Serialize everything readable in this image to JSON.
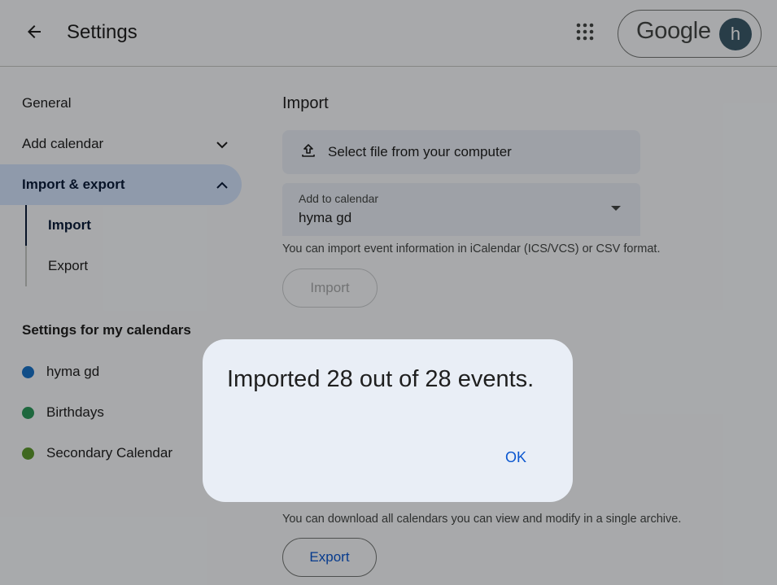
{
  "header": {
    "title": "Settings",
    "logo_text": "Google",
    "avatar_letter": "h"
  },
  "sidebar": {
    "items": [
      {
        "label": "General"
      },
      {
        "label": "Add calendar"
      },
      {
        "label": "Import & export"
      }
    ],
    "sub_items": [
      {
        "label": "Import"
      },
      {
        "label": "Export"
      }
    ],
    "my_calendars_heading": "Settings for my calendars",
    "calendars": [
      {
        "label": "hyma gd",
        "color": "#1a73c9"
      },
      {
        "label": "Birthdays",
        "color": "#2d9a5c"
      },
      {
        "label": "Secondary Calendar",
        "color": "#5e9a2e"
      }
    ]
  },
  "main": {
    "import_title": "Import",
    "file_button_label": "Select file from your computer",
    "calendar_select": {
      "label": "Add to calendar",
      "value": "hyma gd"
    },
    "import_help": "You can import event information in iCalendar (ICS/VCS) or CSV format.",
    "import_button": "Import",
    "export_help": "You can download all calendars you can view and modify in a single archive.",
    "export_button": "Export"
  },
  "dialog": {
    "message": "Imported 28 out of 28 events.",
    "ok_label": "OK"
  },
  "colors": {
    "accent": "#0b57d0",
    "active_nav": "#d3e3fd",
    "dialog_bg": "#e9eef6"
  }
}
